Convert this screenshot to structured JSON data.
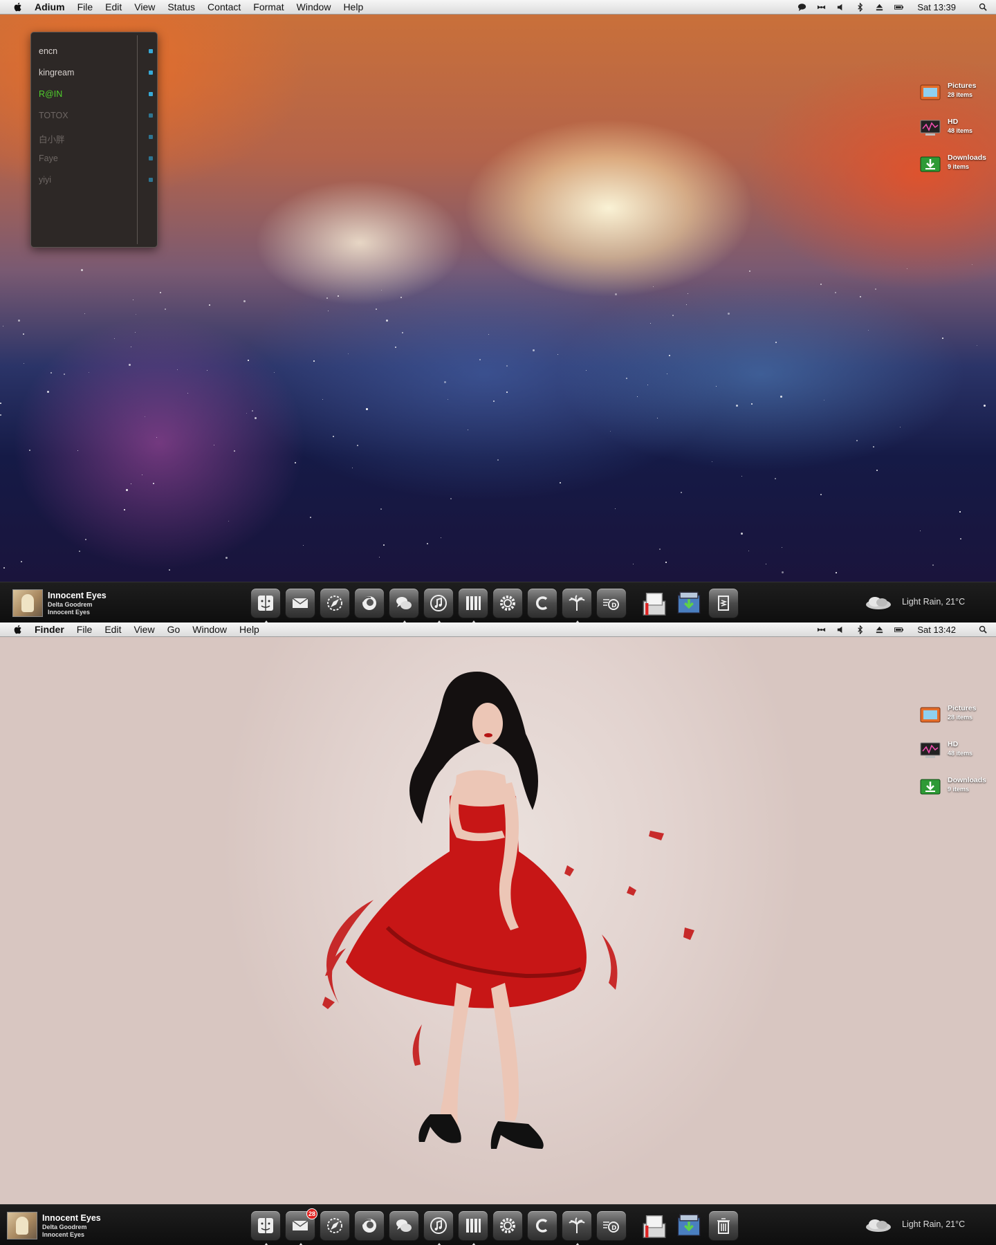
{
  "top": {
    "menubar": {
      "app": "Adium",
      "items": [
        "File",
        "Edit",
        "View",
        "Status",
        "Contact",
        "Format",
        "Window",
        "Help"
      ],
      "clock": "Sat 13:39"
    },
    "contacts": [
      {
        "name": "encn",
        "status": "available"
      },
      {
        "name": "kingream",
        "status": "available"
      },
      {
        "name": "R@IN",
        "status": "online"
      },
      {
        "name": "TOTOX",
        "status": "away"
      },
      {
        "name": "白小胖",
        "status": "away"
      },
      {
        "name": "Faye",
        "status": "away"
      },
      {
        "name": "yiyi",
        "status": "away"
      }
    ],
    "desktop_icons": [
      {
        "label": "Pictures",
        "sub": "28 items",
        "icon": "pictures-folder-icon"
      },
      {
        "label": "HD",
        "sub": "48 items",
        "icon": "hard-drive-icon"
      },
      {
        "label": "Downloads",
        "sub": "9 items",
        "icon": "downloads-folder-icon"
      }
    ],
    "now_playing": {
      "title": "Innocent Eyes",
      "artist": "Delta Goodrem",
      "album": "Innocent Eyes"
    },
    "weather": "Light Rain, 21°C"
  },
  "bottom": {
    "menubar": {
      "app": "Finder",
      "items": [
        "File",
        "Edit",
        "View",
        "Go",
        "Window",
        "Help"
      ],
      "clock": "Sat 13:42"
    },
    "desktop_icons": [
      {
        "label": "Pictures",
        "sub": "28 items",
        "icon": "pictures-folder-icon"
      },
      {
        "label": "HD",
        "sub": "48 items",
        "icon": "hard-drive-icon"
      },
      {
        "label": "Downloads",
        "sub": "9 items",
        "icon": "downloads-folder-icon"
      }
    ],
    "now_playing": {
      "title": "Innocent Eyes",
      "artist": "Delta Goodrem",
      "album": "Innocent Eyes"
    },
    "weather": "Light Rain, 21°C",
    "mail_badge": "28"
  },
  "dock_icons": [
    "finder-icon",
    "mail-icon",
    "safari-icon",
    "firefox-icon",
    "messages-icon",
    "itunes-icon",
    "books-icon",
    "settings-gear-icon",
    "c-app-icon",
    "palm-tree-icon",
    "dashboard-icon",
    "preview-icon",
    "downloads-stack-icon",
    "documents-stack-icon"
  ],
  "colors": {
    "online": "#50d02c",
    "available": "#d8d2cf",
    "away": "#6e6764",
    "status_dot": "#38a9d6",
    "badge": "#e0201e"
  }
}
